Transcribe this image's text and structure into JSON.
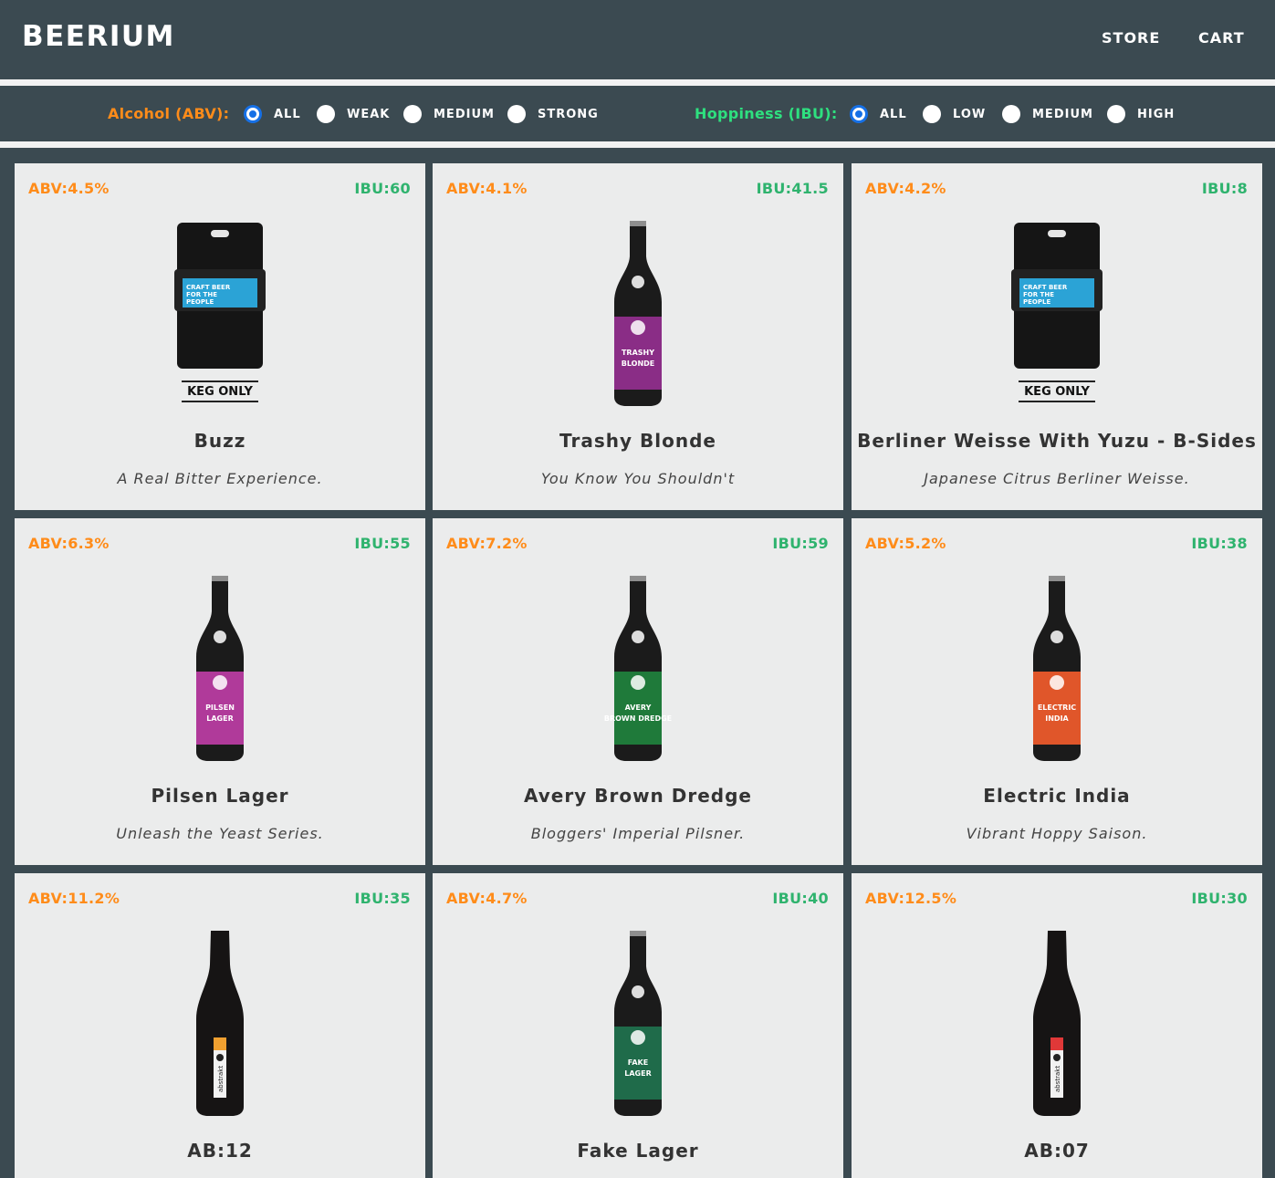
{
  "header": {
    "brand": "BEERIUM",
    "nav": [
      "STORE",
      "CART"
    ]
  },
  "filters": {
    "abv": {
      "label": "Alcohol (ABV):",
      "options": [
        "ALL",
        "WEAK",
        "MEDIUM",
        "STRONG"
      ],
      "selected": "ALL"
    },
    "ibu": {
      "label": "Hoppiness (IBU):",
      "options": [
        "ALL",
        "LOW",
        "MEDIUM",
        "HIGH"
      ],
      "selected": "ALL"
    }
  },
  "colors": {
    "abv": "#ff8c1a",
    "ibu": "#2fb36e",
    "ibu_filter": "#2ee07f",
    "background": "#3b4a51",
    "card": "#ebecec",
    "radio_checked": "#1670e6"
  },
  "beers": [
    {
      "abv": "ABV:4.5%",
      "ibu": "IBU:60",
      "name": "Buzz",
      "tagline": "A Real Bitter Experience.",
      "image": "keg",
      "label_color": "#2ba3d6",
      "keg_text": "KEG ONLY",
      "keg_label": "CRAFT BEER FOR THE PEOPLE"
    },
    {
      "abv": "ABV:4.1%",
      "ibu": "IBU:41.5",
      "name": "Trashy Blonde",
      "tagline": "You Know You Shouldn't",
      "image": "bottle",
      "label_color": "#8a2d86",
      "label_text": "TRASHY BLONDE"
    },
    {
      "abv": "ABV:4.2%",
      "ibu": "IBU:8",
      "name": "Berliner Weisse With Yuzu - B-Sides",
      "tagline": "Japanese Citrus Berliner Weisse.",
      "image": "keg",
      "label_color": "#2ba3d6",
      "keg_text": "KEG ONLY",
      "keg_label": "CRAFT BEER FOR THE PEOPLE"
    },
    {
      "abv": "ABV:6.3%",
      "ibu": "IBU:55",
      "name": "Pilsen Lager",
      "tagline": "Unleash the Yeast Series.",
      "image": "bottle",
      "label_color": "#b03a9a",
      "label_text": "PILSEN LAGER"
    },
    {
      "abv": "ABV:7.2%",
      "ibu": "IBU:59",
      "name": "Avery Brown Dredge",
      "tagline": "Bloggers' Imperial Pilsner.",
      "image": "bottle",
      "label_color": "#1f7a3a",
      "label_text": "AVERY BROWN DREDGE"
    },
    {
      "abv": "ABV:5.2%",
      "ibu": "IBU:38",
      "name": "Electric India",
      "tagline": "Vibrant Hoppy Saison.",
      "image": "bottle",
      "label_color": "#e0562a",
      "label_text": "ELECTRIC INDIA"
    },
    {
      "abv": "ABV:11.2%",
      "ibu": "IBU:35",
      "name": "AB:12",
      "tagline": "",
      "image": "tall",
      "label_color": "#f0a030",
      "label_text": "abstrakt"
    },
    {
      "abv": "ABV:4.7%",
      "ibu": "IBU:40",
      "name": "Fake Lager",
      "tagline": "",
      "image": "bottle",
      "label_color": "#1f6b4a",
      "label_text": "FAKE LAGER"
    },
    {
      "abv": "ABV:12.5%",
      "ibu": "IBU:30",
      "name": "AB:07",
      "tagline": "",
      "image": "tall",
      "label_color": "#e03838",
      "label_text": "abstrakt"
    }
  ]
}
